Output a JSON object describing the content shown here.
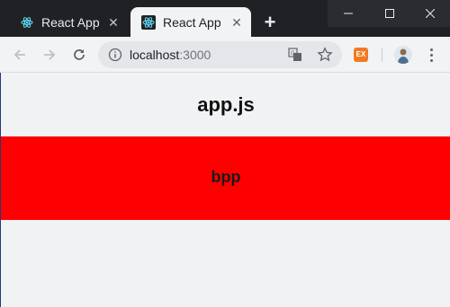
{
  "browser": {
    "tabs": [
      {
        "title": "React App",
        "active": false,
        "favicon": "react-icon"
      },
      {
        "title": "React App",
        "active": true,
        "favicon": "react-icon"
      }
    ],
    "new_tab_icon": "plus-icon",
    "window_controls": [
      "minimize-icon",
      "maximize-icon",
      "close-icon"
    ],
    "address": {
      "host": "localhost",
      "port": ":3000"
    },
    "toolbar_icons": [
      "back-arrow-icon",
      "forward-arrow-icon",
      "reload-icon",
      "info-icon",
      "translate-icon",
      "star-icon",
      "extension-icon",
      "avatar",
      "menu-icon"
    ],
    "extension_label": "EX"
  },
  "page": {
    "heading": "app.js",
    "box_text": "bpp",
    "box_color": "#ff0000"
  }
}
